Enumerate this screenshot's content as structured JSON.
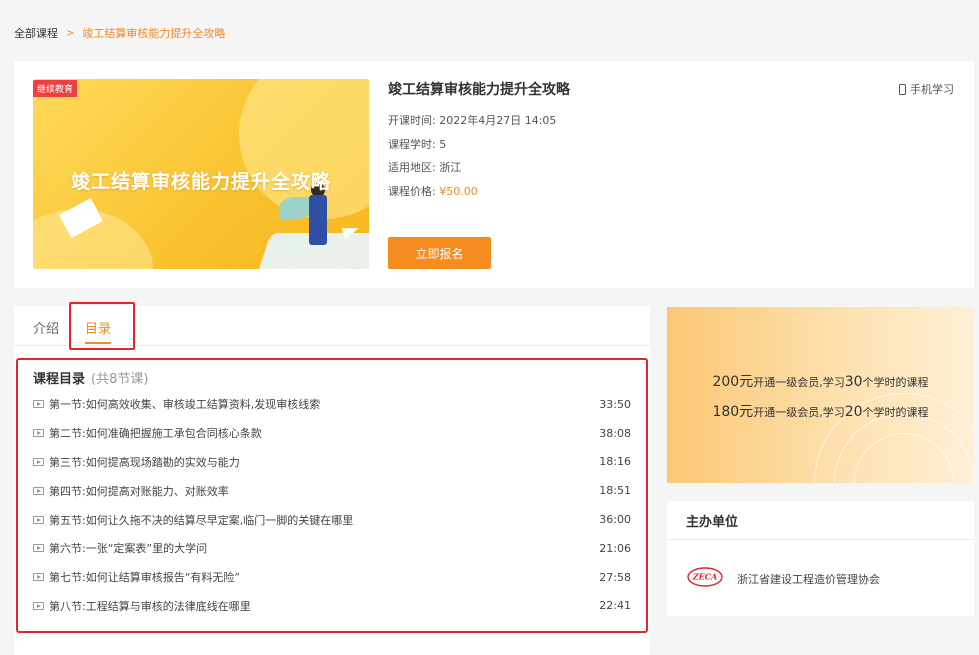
{
  "breadcrumb": {
    "home": "全部课程",
    "separator": ">",
    "current": "竣工结算审核能力提升全攻略"
  },
  "course": {
    "cover_tag": "继续教育",
    "cover_title": "竣工结算审核能力提升全攻略",
    "title": "竣工结算审核能力提升全攻略",
    "start_label": "开课时间:",
    "start_value": "2022年4月27日 14:05",
    "hours_label": "课程学时:",
    "hours_value": "5",
    "region_label": "适用地区:",
    "region_value": "浙江",
    "price_label": "课程价格:",
    "price_value": "¥50.00",
    "mobile_label": "手机学习",
    "enroll_label": "立即报名"
  },
  "tabs": {
    "intro": "介绍",
    "catalog": "目录"
  },
  "catalog": {
    "title": "课程目录",
    "count": "(共8节课)",
    "lessons": [
      {
        "title": "第一节:如何高效收集、审核竣工结算资料,发现审核线索",
        "duration": "33:50"
      },
      {
        "title": "第二节:如何准确把握施工承包合同核心条款",
        "duration": "38:08"
      },
      {
        "title": "第三节:如何提高现场踏勘的实效与能力",
        "duration": "18:16"
      },
      {
        "title": "第四节:如何提高对账能力、对账效率",
        "duration": "18:51"
      },
      {
        "title": "第五节:如何让久拖不决的结算尽早定案,临门一脚的关键在哪里",
        "duration": "36:00"
      },
      {
        "title": "第六节:一张“定案表”里的大学问",
        "duration": "21:06"
      },
      {
        "title": "第七节:如何让结算审核报告“有料无险”",
        "duration": "27:58"
      },
      {
        "title": "第八节:工程结算与审核的法律底线在哪里",
        "duration": "22:41"
      }
    ]
  },
  "promo": {
    "line1_price": "200元",
    "line1_mid": "开通一级会员,学习",
    "line1_hours": "30",
    "line1_tail": "个学时的课程",
    "line2_price": "180元",
    "line2_mid": "开通一级会员,学习",
    "line2_hours": "20",
    "line2_tail": "个学时的课程"
  },
  "organizer": {
    "title": "主办单位",
    "logo_text": "ZECA",
    "name": "浙江省建设工程造价管理协会"
  },
  "colors": {
    "accent": "#f08a24",
    "highlight": "#e3262c",
    "tag": "#ef3f3f"
  }
}
